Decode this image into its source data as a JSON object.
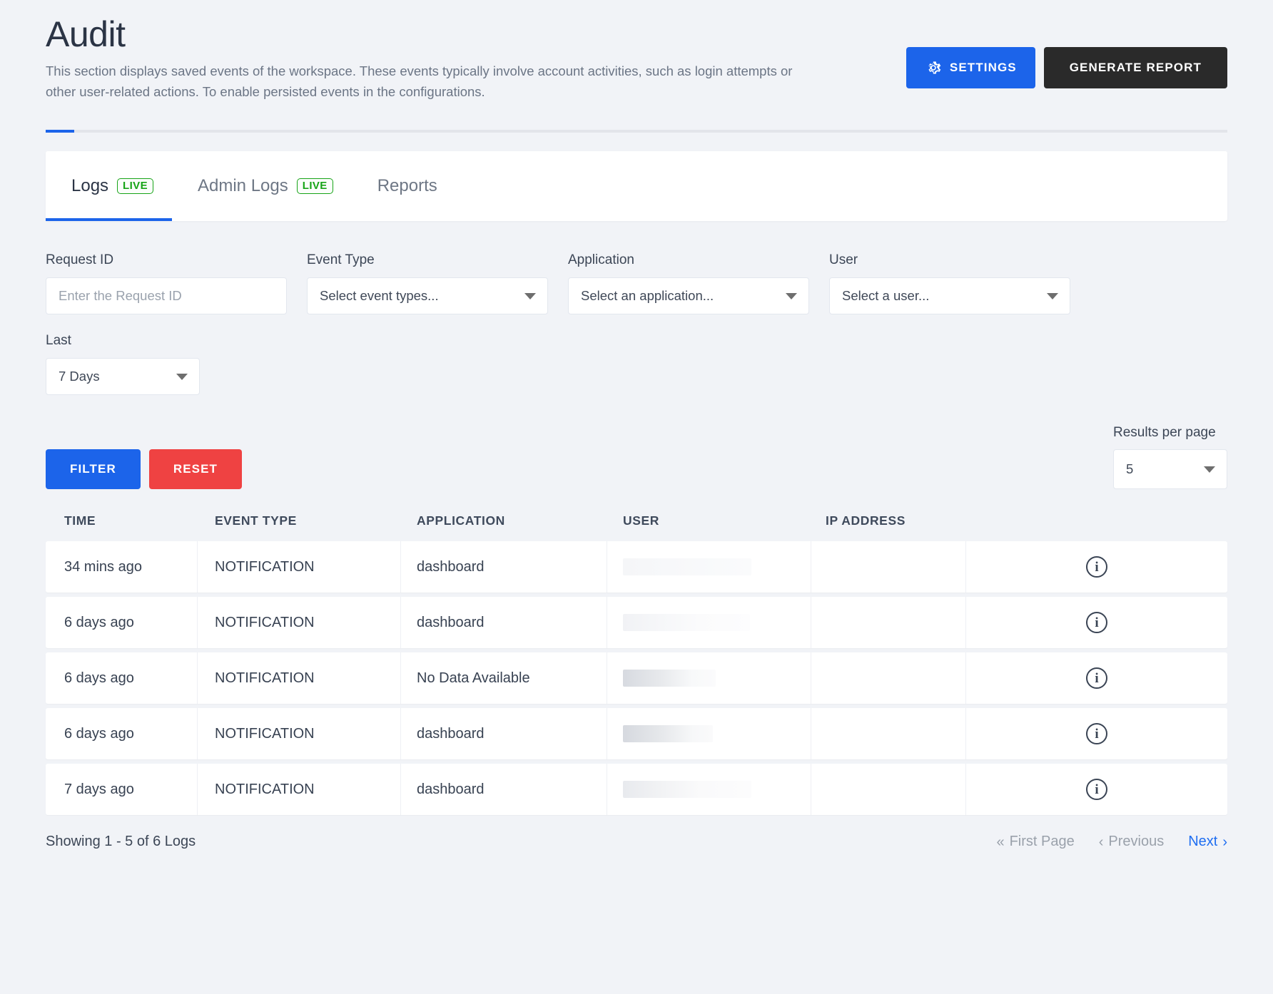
{
  "header": {
    "title": "Audit",
    "description": "This section displays saved events of the workspace. These events typically involve account activities, such as login attempts or other user-related actions. To enable persisted events in the configurations.",
    "settings_label": "SETTINGS",
    "generate_report_label": "GENERATE REPORT",
    "settings_icon": "gear-icon",
    "accent_blue": "#1c64ea",
    "dark_button": "#2a2a2a"
  },
  "tabs": [
    {
      "label": "Logs",
      "badge": "LIVE",
      "active": true
    },
    {
      "label": "Admin Logs",
      "badge": "LIVE",
      "active": false
    },
    {
      "label": "Reports",
      "badge": "",
      "active": false
    }
  ],
  "filters": {
    "request_id": {
      "label": "Request ID",
      "placeholder": "Enter the Request ID",
      "value": ""
    },
    "event_type": {
      "label": "Event Type",
      "value": "Select event types..."
    },
    "application": {
      "label": "Application",
      "value": "Select an application..."
    },
    "user": {
      "label": "User",
      "value": "Select a user..."
    },
    "last": {
      "label": "Last",
      "value": "7 Days"
    },
    "filter_button": "FILTER",
    "reset_button": "RESET",
    "filter_color": "#1c64ea",
    "reset_color": "#ef4242"
  },
  "results_per_page": {
    "label": "Results per page",
    "value": "5"
  },
  "table": {
    "columns": [
      "TIME",
      "EVENT TYPE",
      "APPLICATION",
      "USER",
      "IP ADDRESS"
    ],
    "rows": [
      {
        "time": "34 mins ago",
        "event_type": "NOTIFICATION",
        "application": "dashboard",
        "user": "",
        "ip_address": "",
        "info_icon": "info-icon"
      },
      {
        "time": "6 days ago",
        "event_type": "NOTIFICATION",
        "application": "dashboard",
        "user": "",
        "ip_address": "",
        "info_icon": "info-icon"
      },
      {
        "time": "6 days ago",
        "event_type": "NOTIFICATION",
        "application": "No Data Available",
        "user": "",
        "ip_address": "",
        "info_icon": "info-icon"
      },
      {
        "time": "6 days ago",
        "event_type": "NOTIFICATION",
        "application": "dashboard",
        "user": "",
        "ip_address": "",
        "info_icon": "info-icon"
      },
      {
        "time": "7 days ago",
        "event_type": "NOTIFICATION",
        "application": "dashboard",
        "user": "",
        "ip_address": "",
        "info_icon": "info-icon"
      }
    ]
  },
  "footer": {
    "showing": "Showing 1 - 5 of 6 Logs",
    "first_page": "First Page",
    "previous": "Previous",
    "next": "Next"
  }
}
